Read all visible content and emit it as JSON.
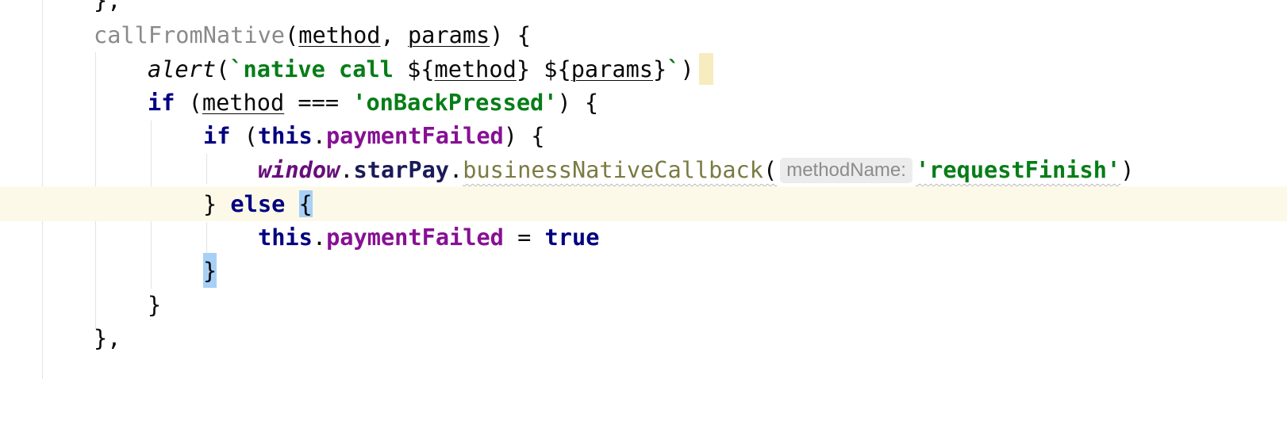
{
  "editor": {
    "lines": {
      "l0": {
        "text": "},",
        "clipped": true
      },
      "l1": {
        "name": "callFromNative",
        "open": "(",
        "p1": "method",
        "comma": ", ",
        "p2": "params",
        "close": ") {"
      },
      "l2": {
        "fn": "alert",
        "open": "(",
        "str1": "`native call ",
        "d1": "${",
        "p1": "method",
        "d2": "} ${",
        "p2": "params",
        "d3": "}",
        "str2": "`",
        "close": ")"
      },
      "l3": {
        "kw": "if",
        "open": " (",
        "p1": "method",
        "op": " === ",
        "str": "'onBackPressed'",
        "close": ") {"
      },
      "l4": {
        "kw": "if",
        "open": " (",
        "this": "this",
        "dot": ".",
        "prop": "paymentFailed",
        "close": ") {"
      },
      "l5": {
        "global": "window",
        "dot1": ".",
        "field": "starPay",
        "dot2": ".",
        "call": "businessNativeCallback",
        "open": "(",
        "hint": "methodName:",
        "str": "'requestFinish'",
        "close": ")"
      },
      "l6": {
        "close_brace": "}",
        "else": " else ",
        "open_brace": "{"
      },
      "l7": {
        "this": "this",
        "dot": ".",
        "prop": "paymentFailed",
        "op": " = ",
        "val": "true"
      },
      "l8": {
        "brace": "}"
      },
      "l9": {
        "brace": "}"
      },
      "l10": {
        "brace": "},",
        "text": "},"
      }
    },
    "colors": {
      "background": "#ffffff",
      "current_line": "#fdf9e8",
      "string": "#067d17",
      "keyword": "#000080",
      "property": "#871094",
      "brace_match": "#a7d0f7"
    }
  }
}
